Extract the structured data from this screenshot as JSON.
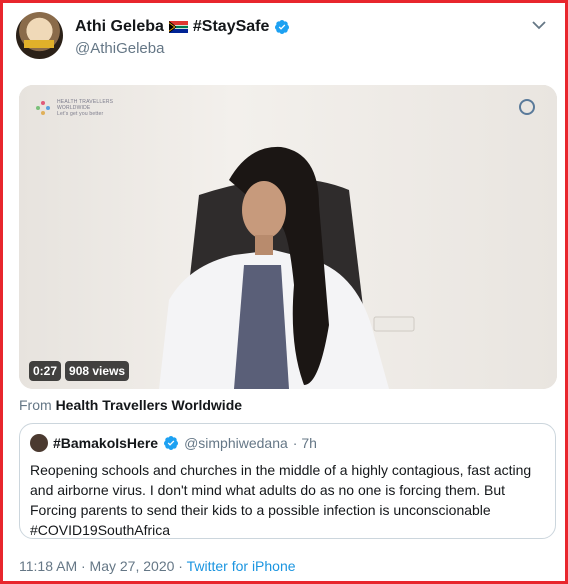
{
  "tweet": {
    "display_name": "Athi Geleba",
    "hashtag": "#StaySafe",
    "handle": "@AthiGeleba",
    "source_prefix": "From",
    "source_name": "Health Travellers Worldwide",
    "timestamp": "11:18 AM · May 27, 2020",
    "client": "Twitter for iPhone"
  },
  "video": {
    "duration": "0:27",
    "views": "908 views",
    "brand_line1": "HEALTH TRAVELLERS",
    "brand_line2": "WORLDWIDE",
    "brand_line3": "Let's get you better"
  },
  "quoted": {
    "name": "#BamakoIsHere",
    "handle": "@simphiwedana",
    "time": "· 7h",
    "text": "Reopening schools and churches in the middle of a highly contagious, fast acting and airborne virus. I don't mind what adults do as no one is forcing them. But Forcing parents to send their kids to a possible infection is unconscionable #COVID19SouthAfrica"
  },
  "icons": [
    "south-africa-flag-icon",
    "verified-icon",
    "chevron-down-icon"
  ],
  "colors": {
    "border": "#e8262d",
    "accent": "#1b95e0",
    "muted": "#657786"
  }
}
